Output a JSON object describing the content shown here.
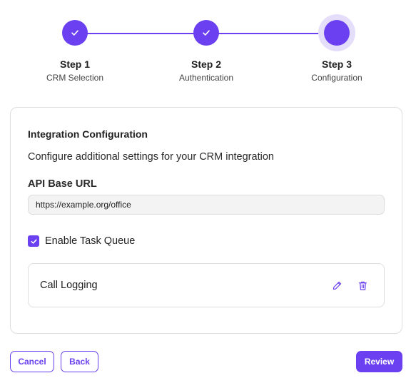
{
  "stepper": {
    "steps": [
      {
        "title": "Step 1",
        "subtitle": "CRM Selection",
        "status": "completed",
        "icon": "check-icon"
      },
      {
        "title": "Step 2",
        "subtitle": "Authentication",
        "status": "completed",
        "icon": "check-icon"
      },
      {
        "title": "Step 3",
        "subtitle": "Configuration",
        "status": "active",
        "icon": ""
      }
    ]
  },
  "card": {
    "title": "Integration Configuration",
    "description": "Configure additional settings for your CRM integration",
    "api_base_url": {
      "label": "API Base URL",
      "value": "https://example.org/office"
    },
    "task_queue": {
      "label": "Enable Task Queue",
      "checked": true,
      "icon": "check-icon"
    },
    "items": [
      {
        "label": "Call Logging",
        "edit_icon": "pencil-icon",
        "delete_icon": "trash-icon"
      }
    ]
  },
  "footer": {
    "cancel_label": "Cancel",
    "back_label": "Back",
    "review_label": "Review"
  },
  "colors": {
    "accent": "#6a40f0",
    "accent_halo": "#e4defb",
    "border": "#dedede",
    "input_bg": "#f3f3f3"
  }
}
